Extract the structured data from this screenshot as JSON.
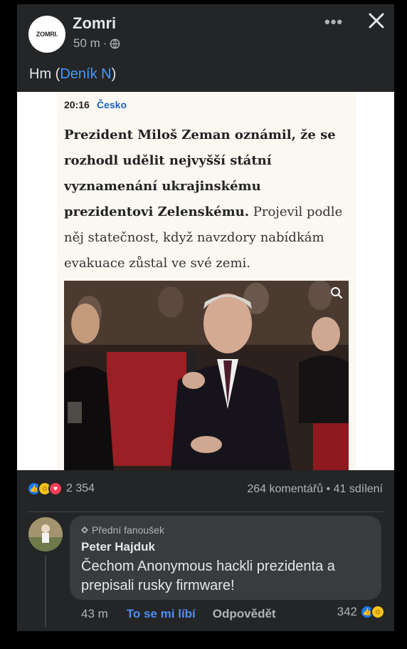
{
  "post": {
    "page_name": "Zomri",
    "page_logo_text": "ZOMRI.",
    "time": "50 m",
    "separator": "·",
    "text_prefix": "Hm (",
    "text_link": "Deník N",
    "text_suffix": ")"
  },
  "article": {
    "time": "20:16",
    "category": "Česko",
    "headline_bold": "Prezident Miloš Zeman oznámil, že se rozhodl udělit nejvyšší státní vyznamenání ukrajinskému prezidentovi Zelenskému.",
    "headline_rest": " Projevil podle něj statečnost, když navzdory nabídkám evakuace zůstal ve své zemi."
  },
  "reactions": {
    "count": "2 354",
    "comments": "264 komentářů",
    "dot": "•",
    "shares": "41 sdílení",
    "icons": [
      "like-icon",
      "haha-icon",
      "love-icon"
    ]
  },
  "comment": {
    "badge": "Přední fanoušek",
    "name": "Peter Hajduk",
    "text": "Čechom Anonymous hackli prezidenta a prepisali rusky firmware!",
    "time": "43 m",
    "like_label": "To se mi líbí",
    "reply_label": "Odpovědět",
    "react_count": "342"
  },
  "colors": {
    "background": "#242526",
    "link": "#4599ff",
    "bubble": "#3a3b3c",
    "like": "#1877f2"
  }
}
